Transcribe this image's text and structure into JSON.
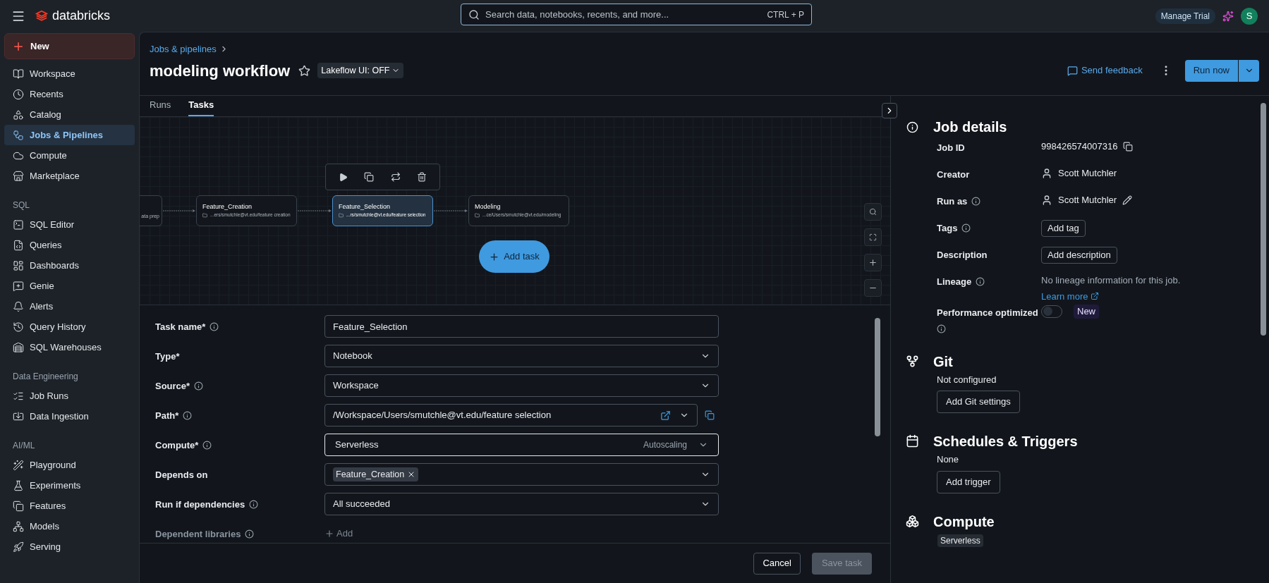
{
  "topbar": {
    "brand": "databricks",
    "search": {
      "placeholder": "Search data, notebooks, recents, and more...",
      "shortcut": "CTRL + P"
    },
    "trial": "Manage Trial",
    "avatar": "S"
  },
  "sidebar": {
    "new": "New",
    "sections": [
      {
        "items": [
          {
            "label": "Workspace",
            "selected": false
          },
          {
            "label": "Recents",
            "selected": false
          },
          {
            "label": "Catalog",
            "selected": false
          },
          {
            "label": "Jobs & Pipelines",
            "selected": true
          },
          {
            "label": "Compute",
            "selected": false
          },
          {
            "label": "Marketplace",
            "selected": false
          }
        ]
      },
      {
        "heading": "SQL",
        "items": [
          {
            "label": "SQL Editor",
            "selected": false
          },
          {
            "label": "Queries",
            "selected": false
          },
          {
            "label": "Dashboards",
            "selected": false
          },
          {
            "label": "Genie",
            "selected": false
          },
          {
            "label": "Alerts",
            "selected": false
          },
          {
            "label": "Query History",
            "selected": false
          },
          {
            "label": "SQL Warehouses",
            "selected": false
          }
        ]
      },
      {
        "heading": "Data Engineering",
        "items": [
          {
            "label": "Job Runs",
            "selected": false
          },
          {
            "label": "Data Ingestion",
            "selected": false
          }
        ]
      },
      {
        "heading": "AI/ML",
        "items": [
          {
            "label": "Playground",
            "selected": false
          },
          {
            "label": "Experiments",
            "selected": false
          },
          {
            "label": "Features",
            "selected": false
          },
          {
            "label": "Models",
            "selected": false
          },
          {
            "label": "Serving",
            "selected": false
          }
        ]
      }
    ]
  },
  "header": {
    "breadcrumb": "Jobs & pipelines",
    "title": "modeling workflow",
    "lakeflow": "Lakeflow UI: OFF",
    "feedback": "Send feedback",
    "run": "Run now"
  },
  "tabs": [
    {
      "label": "Runs",
      "selected": false
    },
    {
      "label": "Tasks",
      "selected": true
    }
  ],
  "dag": {
    "nodes": [
      {
        "path": "ata prep",
        "partial": true,
        "selected": false
      },
      {
        "title": "Feature_Creation",
        "path": "...ers/smutchle@vt.edu/feature creation",
        "partial": false,
        "selected": false
      },
      {
        "title": "Feature_Selection",
        "path": "...rs/smutchle@vt.edu/feature selection",
        "partial": false,
        "selected": true
      },
      {
        "title": "Modeling",
        "path": "...ce/Users/smutchle@vt.edu/modeling",
        "partial": false,
        "selected": false
      }
    ],
    "add_task": "Add task"
  },
  "form": {
    "rows": [
      {
        "label": "Task name*",
        "info": true,
        "kind": "input",
        "value": "Feature_Selection"
      },
      {
        "label": "Type*",
        "info": false,
        "kind": "select",
        "value": "Notebook"
      },
      {
        "label": "Source*",
        "info": true,
        "kind": "select",
        "value": "Workspace"
      },
      {
        "label": "Path*",
        "info": true,
        "kind": "path",
        "value": "/Workspace/Users/smutchle@vt.edu/feature selection"
      },
      {
        "label": "Compute*",
        "info": true,
        "kind": "compute",
        "value": "Serverless",
        "hint": "Autoscaling"
      },
      {
        "label": "Depends on",
        "info": false,
        "kind": "tags",
        "tags": [
          "Feature_Creation"
        ]
      },
      {
        "label": "Run if dependencies",
        "info": true,
        "kind": "select",
        "value": "All succeeded"
      },
      {
        "label": "Dependent libraries",
        "info": true,
        "kind": "add",
        "value": "Add"
      }
    ],
    "cancel": "Cancel",
    "save": "Save task"
  },
  "details": {
    "title": "Job details",
    "rows": [
      {
        "label": "Job ID",
        "info": false,
        "kind": "copy",
        "value": "998426574007316"
      },
      {
        "label": "Creator",
        "info": false,
        "kind": "person",
        "value": "Scott Mutchler",
        "editable": false
      },
      {
        "label": "Run as",
        "info": true,
        "kind": "person",
        "value": "Scott Mutchler",
        "editable": true
      },
      {
        "label": "Tags",
        "info": true,
        "kind": "button",
        "value": "Add tag"
      },
      {
        "label": "Description",
        "info": false,
        "kind": "button",
        "value": "Add description"
      },
      {
        "label": "Lineage",
        "info": true,
        "kind": "lineage",
        "value": "No lineage information for this job.",
        "link": "Learn more"
      },
      {
        "label": "Performance optimized",
        "info": true,
        "kind": "toggle",
        "on": false,
        "badge": "New"
      }
    ]
  },
  "git": {
    "title": "Git",
    "status": "Not configured",
    "button": "Add Git settings"
  },
  "schedules": {
    "title": "Schedules & Triggers",
    "status": "None",
    "button": "Add trigger"
  },
  "compute": {
    "title": "Compute",
    "badge": "Serverless"
  }
}
